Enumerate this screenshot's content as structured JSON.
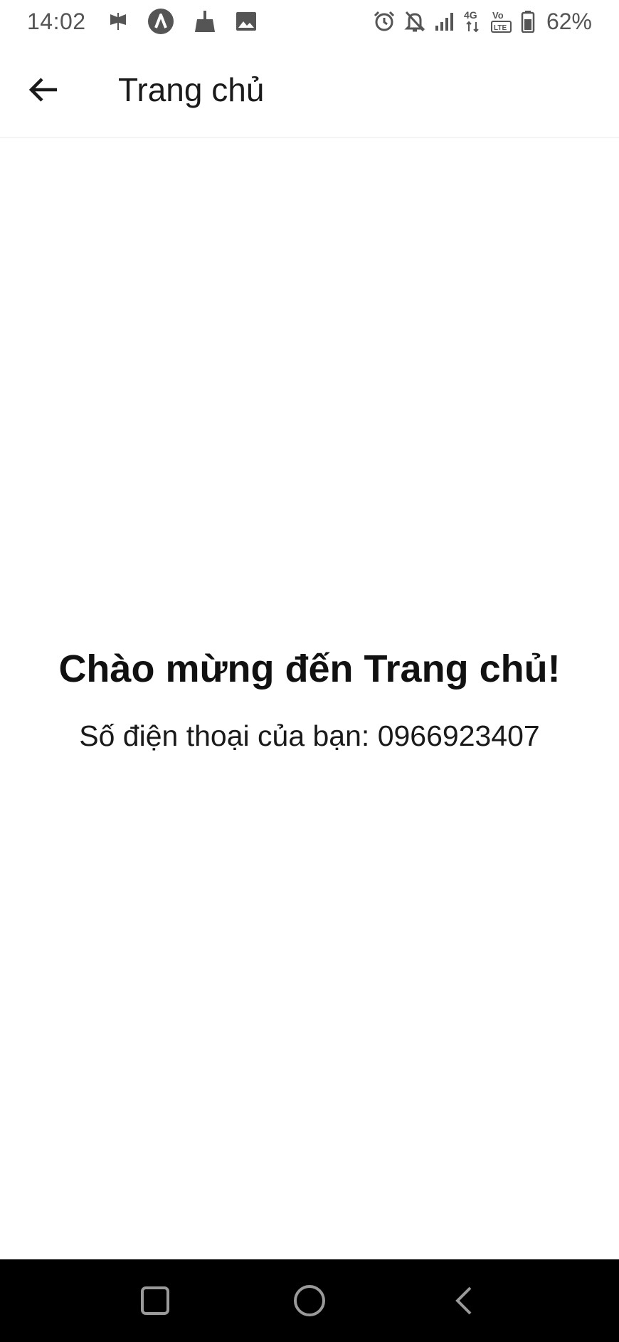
{
  "status_bar": {
    "time": "14:02",
    "left_icons": [
      "usb-debug-icon",
      "app-a-icon",
      "cleaner-icon",
      "gallery-icon"
    ],
    "right_icons": [
      "alarm-icon",
      "notifications-off-icon",
      "signal-icon",
      "network-4g-icon",
      "volte-icon",
      "battery-icon"
    ],
    "battery_percent": "62%",
    "text_color": "#555555"
  },
  "app_bar": {
    "title": "Trang chủ",
    "back_icon": "arrow-left-icon"
  },
  "main": {
    "welcome": "Chào mừng đến Trang chủ!",
    "phone_line": "Số điện thoại của bạn: 0966923407"
  },
  "nav_bar": {
    "background": "#000000",
    "buttons": [
      "recents-icon",
      "home-icon",
      "back-icon"
    ]
  }
}
